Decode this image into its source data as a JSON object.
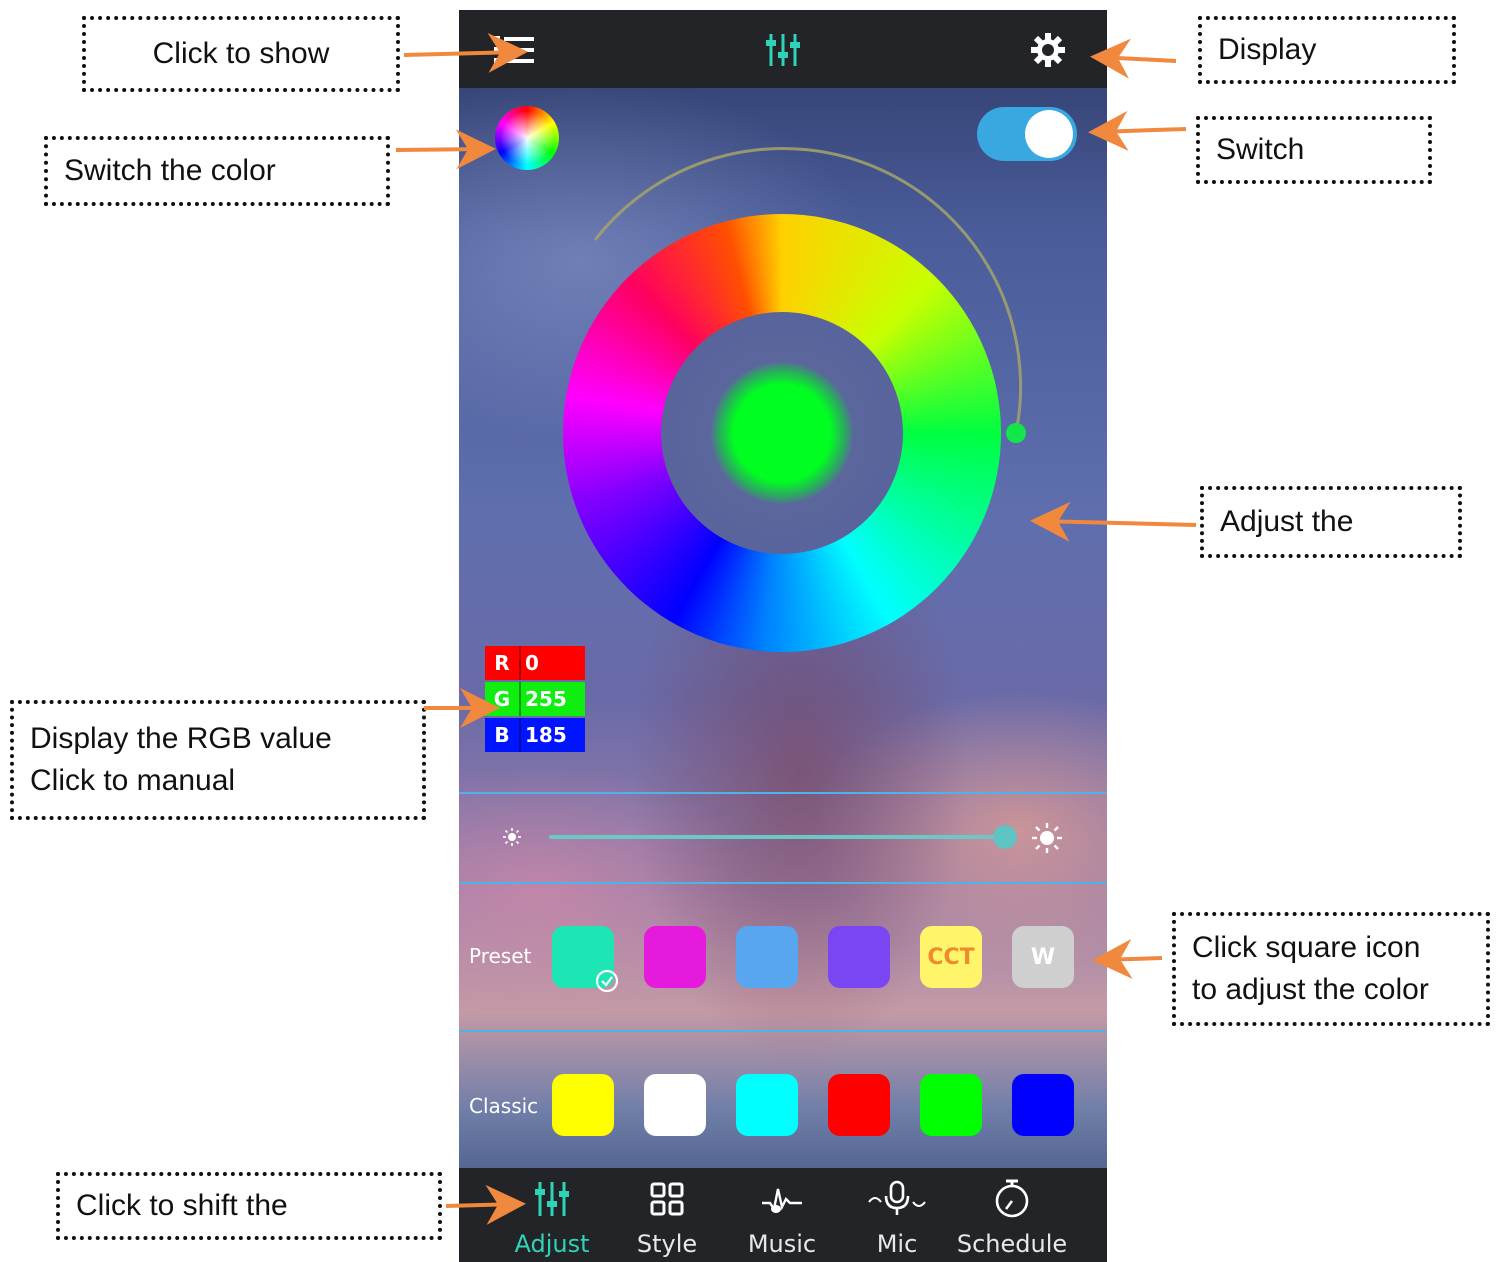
{
  "callouts": {
    "menu": "Click to show",
    "display": "Display",
    "color_switch": "Switch the color",
    "power_switch": "Switch",
    "adjust": "Adjust the",
    "rgb_line1": "Display the RGB value",
    "rgb_line2": "Click to manual",
    "square_line1": "Click square icon",
    "square_line2": "to adjust the color",
    "shift": "Click to shift the"
  },
  "app": {
    "rgb": {
      "r_label": "R",
      "r_value": "0",
      "g_label": "G",
      "g_value": "255",
      "b_label": "B",
      "b_value": "185"
    },
    "power_on": true,
    "brightness_level": 0.98,
    "preset": {
      "label": "Preset",
      "swatches": [
        {
          "color": "#1de6b4",
          "text": "",
          "selected": true
        },
        {
          "color": "#e61adc",
          "text": ""
        },
        {
          "color": "#58a6f0",
          "text": ""
        },
        {
          "color": "#7a45f2",
          "text": ""
        },
        {
          "color": "#fff56a",
          "text": "CCT",
          "text_color": "#f08a2a"
        },
        {
          "color": "#cfcfcf",
          "text": "W",
          "text_color": "#ffffff"
        }
      ]
    },
    "classic": {
      "label": "Classic",
      "swatches": [
        {
          "color": "#ffff00"
        },
        {
          "color": "#ffffff"
        },
        {
          "color": "#00ffff"
        },
        {
          "color": "#ff0000"
        },
        {
          "color": "#00ff00"
        },
        {
          "color": "#0000ff"
        }
      ]
    },
    "tabs": [
      {
        "label": "Adjust",
        "icon": "sliders-icon",
        "active": true
      },
      {
        "label": "Style",
        "icon": "grid-icon"
      },
      {
        "label": "Music",
        "icon": "music-note-icon"
      },
      {
        "label": "Mic",
        "icon": "microphone-icon"
      },
      {
        "label": "Schedule",
        "icon": "timer-icon"
      }
    ],
    "colors": {
      "accent": "#2fd3b8",
      "bar": "#222428",
      "switch_on": "#3aa8e0",
      "arrow": "#f0883e",
      "selected_color": "#00ff20"
    }
  }
}
